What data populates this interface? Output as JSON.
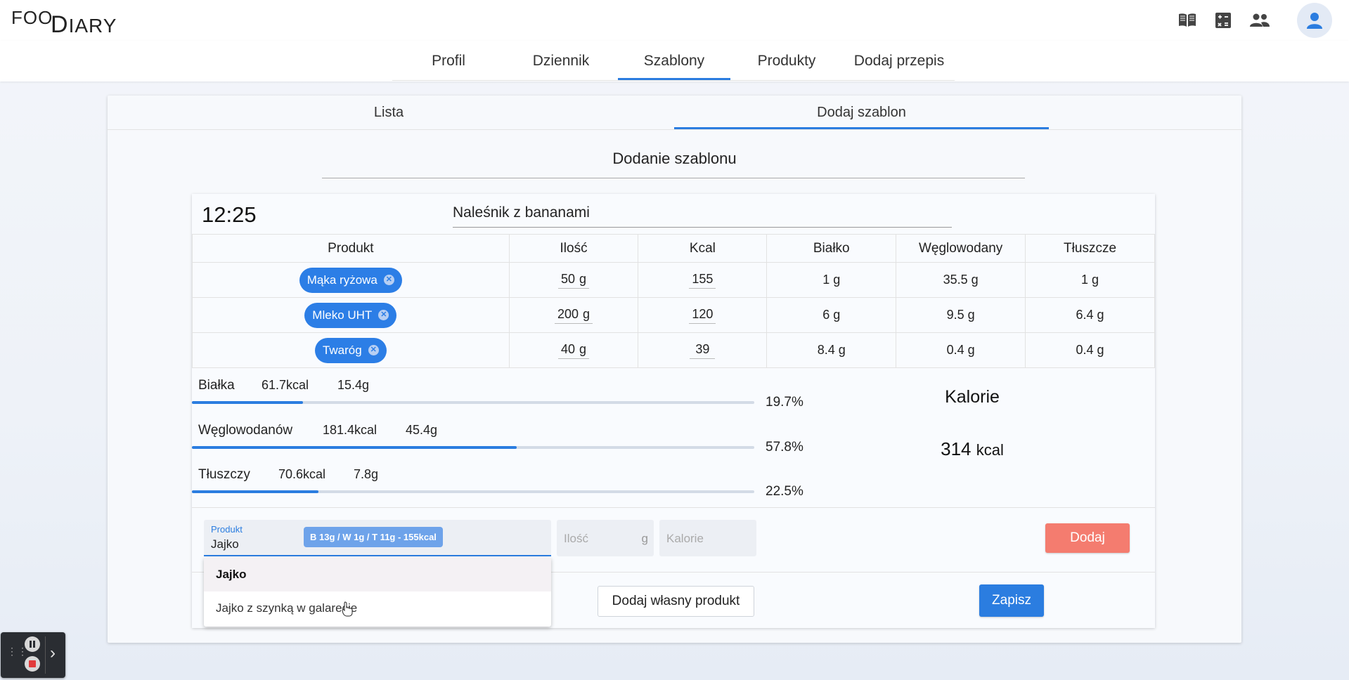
{
  "app": {
    "logo_top": "FOO",
    "logo_main_first": "D",
    "logo_main_rest": "IARY"
  },
  "top_icons": [
    "book-icon",
    "calculator-icon",
    "people-icon",
    "user-avatar-icon"
  ],
  "nav": {
    "tabs": [
      {
        "label": "Profil"
      },
      {
        "label": "Dziennik"
      },
      {
        "label": "Szablony",
        "active": true
      },
      {
        "label": "Produkty"
      },
      {
        "label": "Dodaj przepis"
      }
    ]
  },
  "subtabs": [
    {
      "label": "Lista"
    },
    {
      "label": "Dodaj szablon",
      "active": true
    }
  ],
  "section_title": "Dodanie szablonu",
  "meal": {
    "time": "12:25",
    "name": "Naleśnik z bananami"
  },
  "table": {
    "headers": [
      "Produkt",
      "Ilość",
      "Kcal",
      "Białko",
      "Węglowodany",
      "Tłuszcze"
    ],
    "rows": [
      {
        "product": "Mąka ryżowa",
        "qty": "50",
        "unit": "g",
        "kcal": "155",
        "protein": "1 g",
        "carbs": "35.5 g",
        "fat": "1 g"
      },
      {
        "product": "Mleko UHT",
        "qty": "200",
        "unit": "g",
        "kcal": "120",
        "protein": "6 g",
        "carbs": "9.5 g",
        "fat": "6.4 g"
      },
      {
        "product": "Twaróg",
        "qty": "40",
        "unit": "g",
        "kcal": "39",
        "protein": "8.4 g",
        "carbs": "0.4 g",
        "fat": "0.4 g"
      }
    ]
  },
  "macros": [
    {
      "label": "Białka",
      "kcal": "61.7",
      "kcal_unit": "kcal",
      "grams": "15.4g",
      "pct_text": "19.7%",
      "pct": 19.7
    },
    {
      "label": "Węglowodanów",
      "kcal": "181.4",
      "kcal_unit": "kcal",
      "grams": "45.4g",
      "pct_text": "57.8%",
      "pct": 57.8
    },
    {
      "label": "Tłuszczy",
      "kcal": "70.6",
      "kcal_unit": "kcal",
      "grams": "7.8g",
      "pct_text": "22.5%",
      "pct": 22.5
    }
  ],
  "calories": {
    "title": "Kalorie",
    "value": "314",
    "unit": "kcal"
  },
  "add_form": {
    "product_label": "Produkt",
    "product_value": "Jajko",
    "product_tag": "B 13g / W 1g / T 11g - 155kcal",
    "qty_placeholder": "Ilość",
    "qty_unit": "g",
    "kcal_placeholder": "Kalorie",
    "add_button": "Dodaj"
  },
  "dropdown": {
    "items": [
      {
        "label": "Jajko",
        "selected": true
      },
      {
        "label": "Jajko z szynką w galarecie"
      }
    ]
  },
  "buttons": {
    "own_product": "Dodaj własny produkt",
    "save": "Zapisz"
  },
  "colors": {
    "primary": "#2b7de0",
    "danger": "#f47c6f",
    "chip": "#2c7ee6"
  }
}
